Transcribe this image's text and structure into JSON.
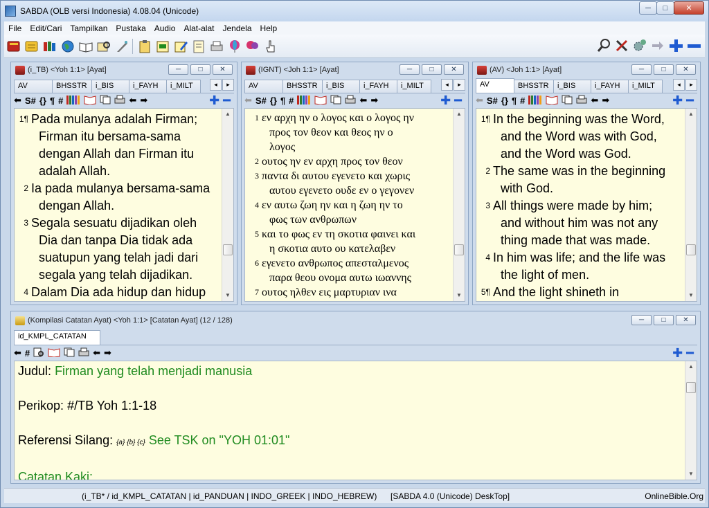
{
  "window": {
    "title": "SABDA (OLB versi Indonesia) 4.08.04  (Unicode)",
    "min": "─",
    "max": "□",
    "close": "✕"
  },
  "menu": [
    "File",
    "Edit/Cari",
    "Tampilkan",
    "Pustaka",
    "Audio",
    "Alat-alat",
    "Jendela",
    "Help"
  ],
  "pane_ctl": {
    "min": "─",
    "max": "□",
    "close": "✕"
  },
  "scroll": {
    "up": "▲",
    "down": "▼"
  },
  "tab_arrows": {
    "left": "◂",
    "right": "▸"
  },
  "pane_tools": {
    "back": "⬅",
    "sym": "S#",
    "braces": "{}",
    "para": "¶",
    "hash": "#",
    "fwd": "➡",
    "plus": "✚",
    "minus": "━"
  },
  "panes": [
    {
      "header": "(i_TB) <Yoh 1:1> [Ayat]",
      "tabs": [
        "AV",
        "BHSSTR",
        "i_BIS",
        "i_FAYH",
        "i_MILT"
      ],
      "active_tab": -1,
      "verses": [
        {
          "num": "1¶",
          "lines": [
            "Pada mulanya adalah Firman;",
            "Firman itu bersama-sama",
            "dengan Allah dan Firman itu",
            "adalah Allah."
          ]
        },
        {
          "num": "2",
          "lines": [
            "Ia pada mulanya bersama-sama",
            "dengan Allah."
          ]
        },
        {
          "num": "3",
          "lines": [
            "Segala sesuatu dijadikan oleh",
            "Dia dan tanpa Dia tidak ada",
            "suatupun yang telah jadi dari",
            "segala yang telah dijadikan."
          ]
        },
        {
          "num": "4",
          "lines": [
            "Dalam Dia ada hidup dan hidup"
          ]
        }
      ]
    },
    {
      "header": "(IGNT) <Joh 1:1> [Ayat]",
      "tabs": [
        "AV",
        "BHSSTR",
        "i_BIS",
        "i_FAYH",
        "i_MILT"
      ],
      "active_tab": -1,
      "verses": [
        {
          "num": "1",
          "lines": [
            "εν αρχη ην ο λογος και ο λογος ην",
            "προς τον θεον και θεος ην ο",
            "λογος"
          ]
        },
        {
          "num": "2",
          "lines": [
            "ουτος ην εν αρχη προς τον θεον"
          ]
        },
        {
          "num": "3",
          "lines": [
            "παντα δι αυτου εγενετο και χωρις",
            "αυτου εγενετο ουδε εν ο γεγονεν"
          ]
        },
        {
          "num": "4",
          "lines": [
            "εν αυτω ζωη ην και η ζωη ην το",
            "φως των ανθρωπων"
          ]
        },
        {
          "num": "5",
          "lines": [
            "και το φως εν τη σκοτια φαινει και",
            "η σκοτια αυτο ου κατελαβεν"
          ]
        },
        {
          "num": "6",
          "lines": [
            "εγενετο ανθρωπος απεσταλμενος",
            "παρα θεου ονομα αυτω ιωαννης"
          ]
        },
        {
          "num": "7",
          "lines": [
            "ουτος ηλθεν εις μαρτυριαν ινα"
          ]
        }
      ]
    },
    {
      "header": "(AV) <Joh 1:1> [Ayat]",
      "tabs": [
        "AV",
        "BHSSTR",
        "i_BIS",
        "i_FAYH",
        "i_MILT"
      ],
      "active_tab": 0,
      "verses": [
        {
          "num": "1¶",
          "lines": [
            "In the beginning was the Word,",
            "and the Word was with God,",
            "and the Word was God."
          ]
        },
        {
          "num": "2",
          "lines": [
            "The same was in the beginning",
            "with God."
          ]
        },
        {
          "num": "3",
          "lines": [
            "All things were made by him;",
            "and without him was not any",
            "thing made that was made."
          ]
        },
        {
          "num": "4",
          "lines": [
            "In him was life; and the life was",
            "the light of men."
          ]
        },
        {
          "num": "5¶",
          "lines": [
            "And the light shineth in"
          ]
        }
      ]
    }
  ],
  "notes_pane": {
    "header": "(Kompilasi Catatan Ayat) <Yoh 1:1> [Catatan Ayat] (12 / 128)",
    "tab": "id_KMPL_CATATAN",
    "judul_label": "Judul:",
    "judul_value": "Firman yang telah menjadi manusia",
    "perikop_label": "Perikop:",
    "perikop_value": "#/TB Yoh 1:1-18",
    "referensi_label": "Referensi Silang:",
    "referensi_refs": "{a} {b} {c}",
    "referensi_value": "See TSK on \"YOH 01:01\"",
    "catatan_label": "Catatan Kaki:"
  },
  "status": {
    "left": "(i_TB* / id_KMPL_CATATAN | id_PANDUAN | INDO_GREEK | INDO_HEBREW)",
    "middle": "[SABDA 4.0 (Unicode) DeskTop]",
    "right": "OnlineBible.Org"
  },
  "toolbar_icons": [
    "bible-book-icon",
    "notes-book-icon",
    "library-books-icon",
    "globe-icon",
    "open-book-icon",
    "search-book-icon",
    "quill-icon",
    "clipboard-icon",
    "verse-list-icon",
    "edit-notes-icon",
    "page-icon",
    "printer-icon",
    "balloon-icon",
    "balloons-icon",
    "hand-pointer-icon"
  ],
  "toolbar_right_icons": [
    "magnifier-icon",
    "tools-icon",
    "gears-icon",
    "arrow-right-icon",
    "plus-icon",
    "minus-icon"
  ]
}
